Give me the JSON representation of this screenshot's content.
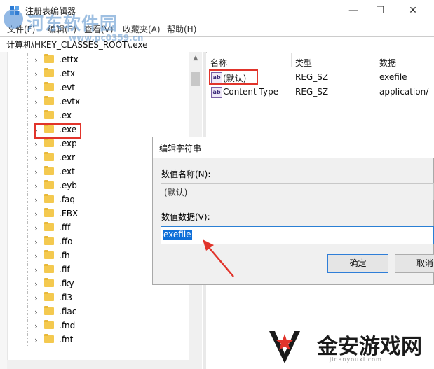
{
  "window": {
    "title": "注册表编辑器",
    "minimize_glyph": "—",
    "maximize_glyph": "☐",
    "close_glyph": "✕"
  },
  "menu": [
    {
      "label": "文件(F)"
    },
    {
      "label": "编辑(E)"
    },
    {
      "label": "查看(V)"
    },
    {
      "label": "收藏夹(A)"
    },
    {
      "label": "帮助(H)"
    }
  ],
  "address": {
    "path": "计算机\\HKEY_CLASSES_ROOT\\.exe"
  },
  "tree": {
    "items": [
      {
        "label": ".ettx"
      },
      {
        "label": ".etx"
      },
      {
        "label": ".evt"
      },
      {
        "label": ".evtx"
      },
      {
        "label": ".ex_"
      },
      {
        "label": ".exe"
      },
      {
        "label": ".exp"
      },
      {
        "label": ".exr"
      },
      {
        "label": ".ext"
      },
      {
        "label": ".eyb"
      },
      {
        "label": ".faq"
      },
      {
        "label": ".FBX"
      },
      {
        "label": ".fff"
      },
      {
        "label": ".ffo"
      },
      {
        "label": ".fh"
      },
      {
        "label": ".fif"
      },
      {
        "label": ".fky"
      },
      {
        "label": ".fl3"
      },
      {
        "label": ".flac"
      },
      {
        "label": ".fnd"
      },
      {
        "label": ".fnt"
      }
    ],
    "selected": ".exe"
  },
  "values_table": {
    "headers": {
      "name": "名称",
      "type": "类型",
      "data": "数据"
    },
    "rows": [
      {
        "name": "(默认)",
        "type": "REG_SZ",
        "data": "exefile",
        "icon": "ab-string-icon"
      },
      {
        "name": "Content Type",
        "type": "REG_SZ",
        "data": "application/",
        "icon": "ab-string-icon"
      }
    ]
  },
  "dialog": {
    "title": "编辑字符串",
    "name_label": "数值名称(N):",
    "name_value": "(默认)",
    "data_label": "数值数据(V):",
    "data_value": "exefile",
    "ok_label": "确定",
    "cancel_label": "取消"
  },
  "watermarks": {
    "top_brand": "河东软件园",
    "top_url": "www.pc0359.cn",
    "bottom_brand": "金安游戏网",
    "bottom_url": "jinanyouxi.com"
  },
  "colors": {
    "highlight_red": "#e1342b",
    "selection_blue": "#0f6fd8",
    "folder_yellow": "#f4c94f"
  }
}
